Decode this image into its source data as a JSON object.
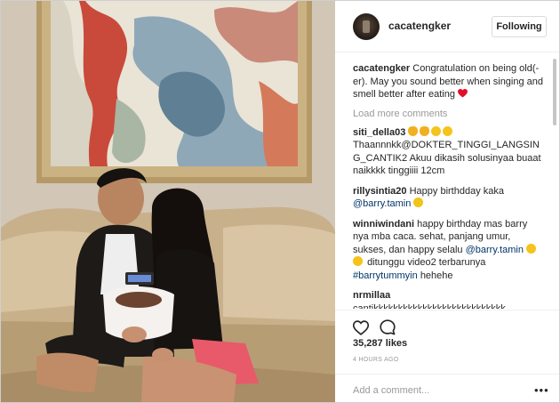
{
  "post": {
    "username": "cacatengker",
    "follow_label": "Following",
    "caption": {
      "user": "cacatengker",
      "text": "Congratulation on being old(-er). May you sound better when singing and smell better after eating"
    },
    "load_more": "Load more comments",
    "comments": [
      {
        "user": "siti_della03",
        "text": "Thaannnkk@DOKTER_TINGGI_LANGSING_CANTIK2 Akuu dikasih solusinyaa buaat naikkkk tinggiiii 12cm"
      },
      {
        "user": "rillysintia20",
        "text": "Happy birthdday kaka",
        "mention": "@barry.tamin"
      },
      {
        "user": "winniwindani",
        "text_a": "happy birthday mas barry nya mba caca. sehat, panjang umur, sukses, dan happy selalu",
        "mention": "@barry.tamin",
        "text_b": "ditunggu video2 terbarunya",
        "hashtag": "#barrytummyin",
        "text_c": "hehehe"
      },
      {
        "user": "nrmillaa",
        "text": "cantikkkkkkkkkkkkkkkkkkkkkkkkkkk"
      }
    ],
    "likes": "35,287 likes",
    "time": "4 HOURS AGO",
    "comment_placeholder": "Add a comment...",
    "more_options": "•••"
  },
  "icons": [
    "heart-outline-icon",
    "comment-bubble-icon",
    "more-options-icon"
  ],
  "colors": {
    "link": "#003569",
    "muted": "#999999",
    "text": "#262626",
    "border": "#dbdbdb"
  }
}
